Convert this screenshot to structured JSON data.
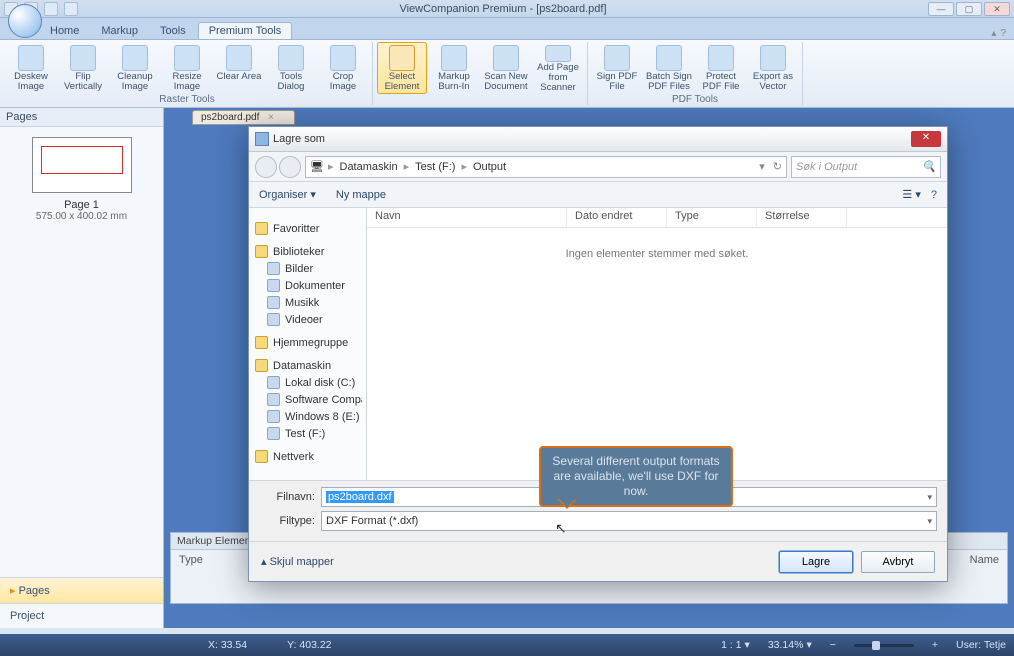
{
  "app": {
    "title": "ViewCompanion Premium - [ps2board.pdf]"
  },
  "tabs": [
    "Home",
    "Markup",
    "Tools",
    "Premium Tools"
  ],
  "active_tab": "Premium Tools",
  "ribbon": {
    "raster": {
      "label": "Raster Tools",
      "buttons": [
        {
          "label": "Deskew Image"
        },
        {
          "label": "Flip Vertically"
        },
        {
          "label": "Cleanup Image"
        },
        {
          "label": "Resize Image"
        },
        {
          "label": "Clear Area"
        },
        {
          "label": "Tools Dialog"
        },
        {
          "label": "Crop Image"
        }
      ]
    },
    "mid": {
      "buttons": [
        {
          "label": "Select Element",
          "selected": true
        },
        {
          "label": "Markup Burn-In"
        },
        {
          "label": "Scan New Document"
        },
        {
          "label": "Add Page from Scanner"
        }
      ]
    },
    "pdf": {
      "label": "PDF Tools",
      "buttons": [
        {
          "label": "Sign PDF File"
        },
        {
          "label": "Batch Sign PDF Files"
        },
        {
          "label": "Protect PDF File"
        },
        {
          "label": "Export as Vector"
        }
      ]
    }
  },
  "pages": {
    "title": "Pages",
    "thumb_label": "Page 1",
    "thumb_dims": "575.00 x 400.02 mm",
    "side_tabs": [
      "Pages",
      "Project"
    ]
  },
  "doc_tab": "ps2board.pdf",
  "markup_panel": {
    "title": "Markup Elements",
    "col1": "Type",
    "col_right": "Name"
  },
  "dialog": {
    "title": "Lagre som",
    "breadcrumb": [
      "Datamaskin",
      "Test (F:)",
      "Output"
    ],
    "search_placeholder": "Søk i Output",
    "toolbar": {
      "organiser": "Organiser ▾",
      "ny_mappe": "Ny mappe"
    },
    "tree": {
      "favoritter": "Favoritter",
      "biblioteker": "Biblioteker",
      "bib_items": [
        "Bilder",
        "Dokumenter",
        "Musikk",
        "Videoer"
      ],
      "hjemmegruppe": "Hjemmegruppe",
      "datamaskin": "Datamaskin",
      "dm_items": [
        "Lokal disk (C:)",
        "Software Compa",
        "Windows 8 (E:)",
        "Test (F:)"
      ],
      "nettverk": "Nettverk"
    },
    "list_headers": [
      "Navn",
      "Dato endret",
      "Type",
      "Størrelse"
    ],
    "empty_text": "Ingen elementer stemmer med søket.",
    "filnavn_label": "Filnavn:",
    "filnavn_value": "ps2board.dxf",
    "filtype_label": "Filtype:",
    "filtype_value": "DXF Format (*.dxf)",
    "skjul": "Skjul mapper",
    "lagre": "Lagre",
    "avbryt": "Avbryt"
  },
  "callout": "Several different output formats are available, we'll use DXF for now.",
  "status": {
    "x": "X: 33.54",
    "y": "Y: 403.22",
    "scale": "1 : 1",
    "zoom": "33.14%",
    "user": "User: Tetje"
  }
}
